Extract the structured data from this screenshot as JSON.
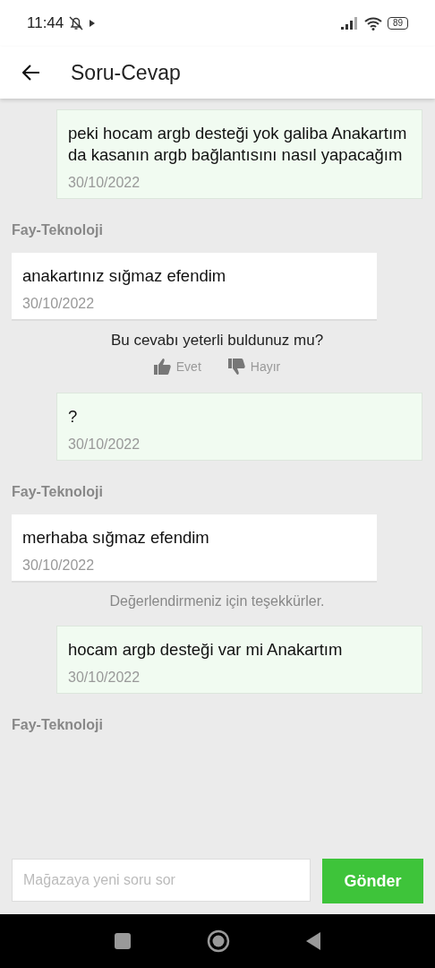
{
  "status_bar": {
    "time": "11:44",
    "battery": "89"
  },
  "header": {
    "title": "Soru-Cevap"
  },
  "messages": [
    {
      "kind": "question",
      "text": "peki hocam argb desteği yok galiba Anakartım da kasanın argb bağlantısını nasıl yapacağım",
      "date": "30/10/2022"
    },
    {
      "kind": "answer",
      "sender": "Fay-Teknoloji",
      "text": "anakartınız sığmaz efendim",
      "date": "30/10/2022"
    },
    {
      "kind": "feedback",
      "prompt": "Bu cevabı yeterli buldunuz mu?",
      "yes": "Evet",
      "no": "Hayır"
    },
    {
      "kind": "question",
      "text": "?",
      "date": "30/10/2022"
    },
    {
      "kind": "answer",
      "sender": "Fay-Teknoloji",
      "text": "merhaba sığmaz efendim",
      "date": "30/10/2022"
    },
    {
      "kind": "note",
      "text": "Değerlendirmeniz için teşekkürler."
    },
    {
      "kind": "question",
      "text": "hocam argb desteği var mi Anakartım",
      "date": "30/10/2022"
    },
    {
      "kind": "sender",
      "sender": "Fay-Teknoloji"
    }
  ],
  "composer": {
    "placeholder": "Mağazaya yeni soru sor",
    "button": "Gönder"
  }
}
